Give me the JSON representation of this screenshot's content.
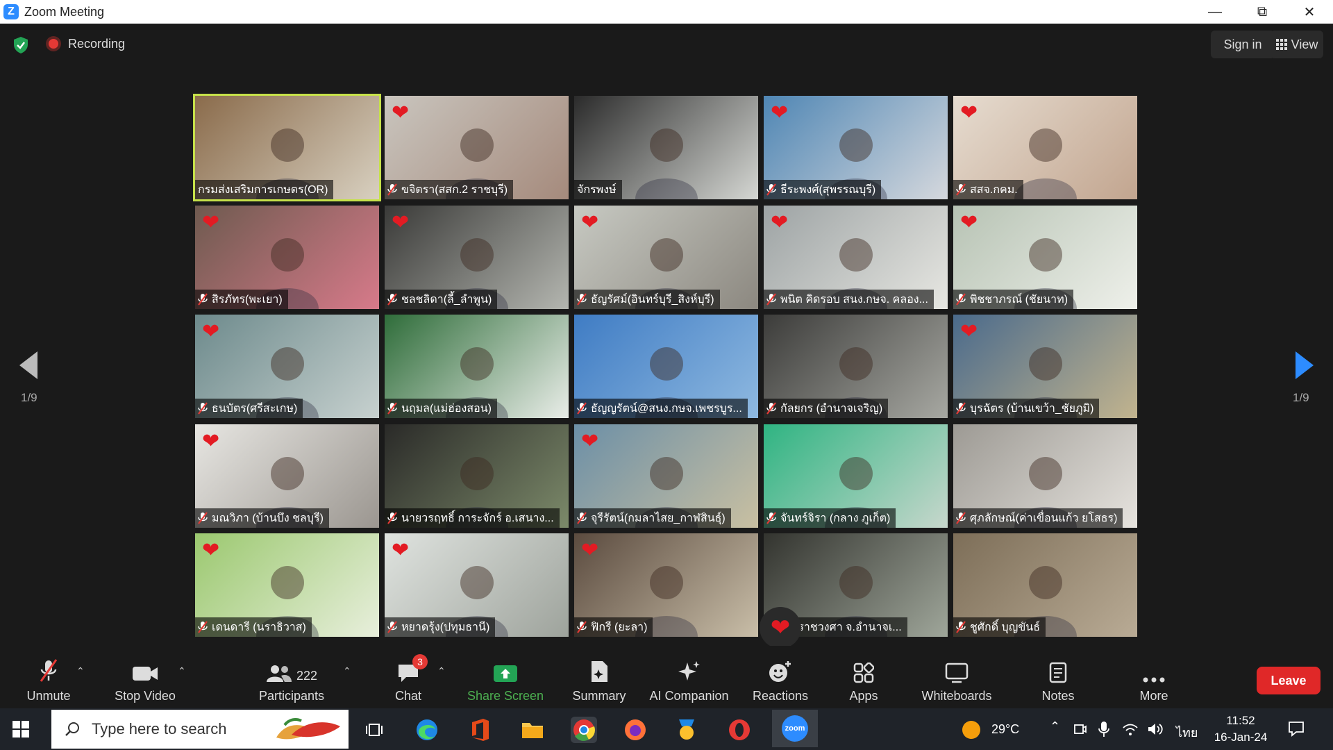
{
  "window": {
    "title": "Zoom Meeting",
    "logo_letter": "Z"
  },
  "topbar": {
    "recording_label": "Recording",
    "sign_in_label": "Sign in",
    "view_label": "View"
  },
  "pagination": {
    "left": "1/9",
    "right": "1/9"
  },
  "participants": [
    {
      "name": "กรมส่งเสริมการเกษตร(OR)",
      "heart": false,
      "muted": false,
      "active": true,
      "bg": [
        "#8a6b4b",
        "#d8d0c0"
      ]
    },
    {
      "name": "ขจิตรา(สสก.2 ราชบุรี)",
      "heart": true,
      "muted": true,
      "active": false,
      "bg": [
        "#c9c5be",
        "#a58a7c"
      ]
    },
    {
      "name": "จักรพงษ์",
      "heart": false,
      "muted": false,
      "active": false,
      "bg": [
        "#2b2b2b",
        "#d5d7d3"
      ]
    },
    {
      "name": "ธีระพงศ์(สุพรรณบุรี)",
      "heart": true,
      "muted": true,
      "active": false,
      "bg": [
        "#4f86b4",
        "#d5d8dd"
      ]
    },
    {
      "name": "สสจ.กคม.",
      "heart": true,
      "muted": true,
      "active": false,
      "bg": [
        "#e6dcd0",
        "#c2a58f"
      ]
    },
    {
      "name": "สิรภัทร(พะเยา)",
      "heart": true,
      "muted": true,
      "active": false,
      "bg": [
        "#6e5a4f",
        "#d77a8a"
      ]
    },
    {
      "name": "ชลชลิดา(ลี้_ลำพูน)",
      "heart": true,
      "muted": true,
      "active": false,
      "bg": [
        "#3a3a38",
        "#b4b6b0"
      ]
    },
    {
      "name": "ธัญรัศม์(อินทร์บุรี_สิงห์บุรี)",
      "heart": true,
      "muted": true,
      "active": false,
      "bg": [
        "#c7c9c2",
        "#8c8880"
      ]
    },
    {
      "name": "พนิต คิดรอบ สนง.กษจ. คลอง...",
      "heart": true,
      "muted": true,
      "active": false,
      "bg": [
        "#9da3a4",
        "#e7e7e2"
      ]
    },
    {
      "name": "พิชชาภรณ์ (ชัยนาท)",
      "heart": true,
      "muted": true,
      "active": false,
      "bg": [
        "#b7c3b4",
        "#eef0ea"
      ]
    },
    {
      "name": "ธนบัตร(ศรีสะเกษ)",
      "heart": true,
      "muted": true,
      "active": false,
      "bg": [
        "#6d8a8c",
        "#c7d1cf"
      ]
    },
    {
      "name": "นฤมล(แม่ฮ่องสอน)",
      "heart": false,
      "muted": true,
      "active": false,
      "bg": [
        "#2f6d3a",
        "#e9ede8"
      ]
    },
    {
      "name": "ธัญญรัตน์@สนง.กษจ.เพชรบูร...",
      "heart": false,
      "muted": true,
      "active": false,
      "bg": [
        "#3f7cc4",
        "#8fb9e0"
      ]
    },
    {
      "name": "กัลยกร (อำนาจเจริญ)",
      "heart": false,
      "muted": true,
      "active": false,
      "bg": [
        "#3c3c3a",
        "#a7a8a2"
      ]
    },
    {
      "name": "บุรฉัตร (บ้านเขว้า_ชัยภูมิ)",
      "heart": true,
      "muted": true,
      "active": false,
      "bg": [
        "#4a6a8b",
        "#c2b48e"
      ]
    },
    {
      "name": "มณวิภา (บ้านบึง ชลบุรี)",
      "heart": true,
      "muted": true,
      "active": false,
      "bg": [
        "#e7e6e2",
        "#9b9690"
      ]
    },
    {
      "name": "นายวรฤทธิ์ การะจักร์ อ.เสนาง...",
      "heart": false,
      "muted": true,
      "active": false,
      "bg": [
        "#2a2a28",
        "#7c8a6a"
      ]
    },
    {
      "name": "จุรีรัตน์(กมลาไสย_กาฬสินธุ์)",
      "heart": true,
      "muted": true,
      "active": false,
      "bg": [
        "#6c8fa6",
        "#c9c0a2"
      ]
    },
    {
      "name": "จันทร์จิรา (กลาง ภูเก็ต)",
      "heart": false,
      "muted": true,
      "active": false,
      "bg": [
        "#2fb482",
        "#c7d7cc"
      ]
    },
    {
      "name": "ศุภลักษณ์(ค่าเขื่อนแก้ว ยโสธร)",
      "heart": false,
      "muted": true,
      "active": false,
      "bg": [
        "#9d9a94",
        "#e6e3de"
      ]
    },
    {
      "name": "เดนดารี (นราธิวาส)",
      "heart": true,
      "muted": true,
      "active": false,
      "bg": [
        "#9bc86f",
        "#e8efdc"
      ]
    },
    {
      "name": "หยาดรุ้ง(ปทุมธานี)",
      "heart": true,
      "muted": true,
      "active": false,
      "bg": [
        "#dfe3df",
        "#9ea39c"
      ]
    },
    {
      "name": "ฟิกรี (ยะลา)",
      "heart": true,
      "muted": true,
      "active": false,
      "bg": [
        "#5b4b3f",
        "#c9bea8"
      ]
    },
    {
      "name": "อ.ปทุมราชวงศา จ.อำนาจเ...",
      "heart": false,
      "muted": false,
      "active": false,
      "bg": [
        "#33342f",
        "#9fa69a"
      ]
    },
    {
      "name": "ชูศักดิ์ บุญขันธ์",
      "heart": false,
      "muted": true,
      "active": false,
      "bg": [
        "#7d6e58",
        "#b9ab95"
      ]
    }
  ],
  "toolbar": {
    "unmute": "Unmute",
    "stop_video": "Stop Video",
    "participants": "Participants",
    "participants_count": "222",
    "chat": "Chat",
    "chat_badge": "3",
    "share_screen": "Share Screen",
    "summary": "Summary",
    "ai_companion": "AI Companion",
    "reactions": "Reactions",
    "apps": "Apps",
    "whiteboards": "Whiteboards",
    "notes": "Notes",
    "more": "More",
    "leave": "Leave"
  },
  "taskbar": {
    "search_placeholder": "Type here to search",
    "weather_temp": "29°C",
    "language": "ไทย",
    "time": "11:52",
    "date": "16-Jan-24",
    "zoom_icon_text": "zoom"
  },
  "colors": {
    "accent": "#2d8cff",
    "leave": "#e02828",
    "share": "#4caf50",
    "heart": "#e31b23",
    "active_border": "#c6e14a"
  }
}
